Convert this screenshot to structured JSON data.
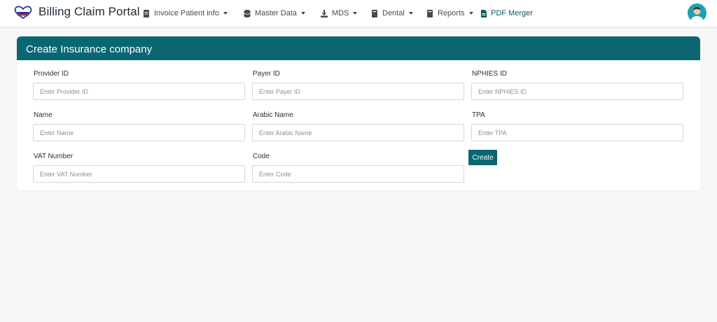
{
  "brand": {
    "title": "Billing Claim Portal",
    "logo_icon": "heart-logo-icon"
  },
  "nav": {
    "items": [
      {
        "label": "Invoice Patient info",
        "icon": "document-icon"
      },
      {
        "label": "Master Data",
        "icon": "database-icon"
      },
      {
        "label": "MDS",
        "icon": "download-icon"
      },
      {
        "label": "Dental",
        "icon": "book-icon"
      },
      {
        "label": "Reports",
        "icon": "book-icon"
      },
      {
        "label": "PDF Merger",
        "icon": "file-pdf-icon"
      }
    ]
  },
  "form": {
    "title": "Create Insurance company",
    "fields": [
      {
        "label": "Provider ID",
        "placeholder": "Enter Provider ID"
      },
      {
        "label": "Payer ID",
        "placeholder": "Enter Payer ID"
      },
      {
        "label": "NPHIES ID",
        "placeholder": "Enter NPHIES ID"
      },
      {
        "label": "Name",
        "placeholder": "Enter Name"
      },
      {
        "label": "Arabic Name",
        "placeholder": "Enter Arabic Name"
      },
      {
        "label": "TPA",
        "placeholder": "Enter TPA"
      },
      {
        "label": "VAT Number",
        "placeholder": "Enter VAT Number"
      },
      {
        "label": "Code",
        "placeholder": "Enter Code"
      }
    ],
    "submit_label": "Create"
  },
  "colors": {
    "primary": "#0a6772",
    "background": "#f7f7fa",
    "nav_text": "#414b54"
  }
}
